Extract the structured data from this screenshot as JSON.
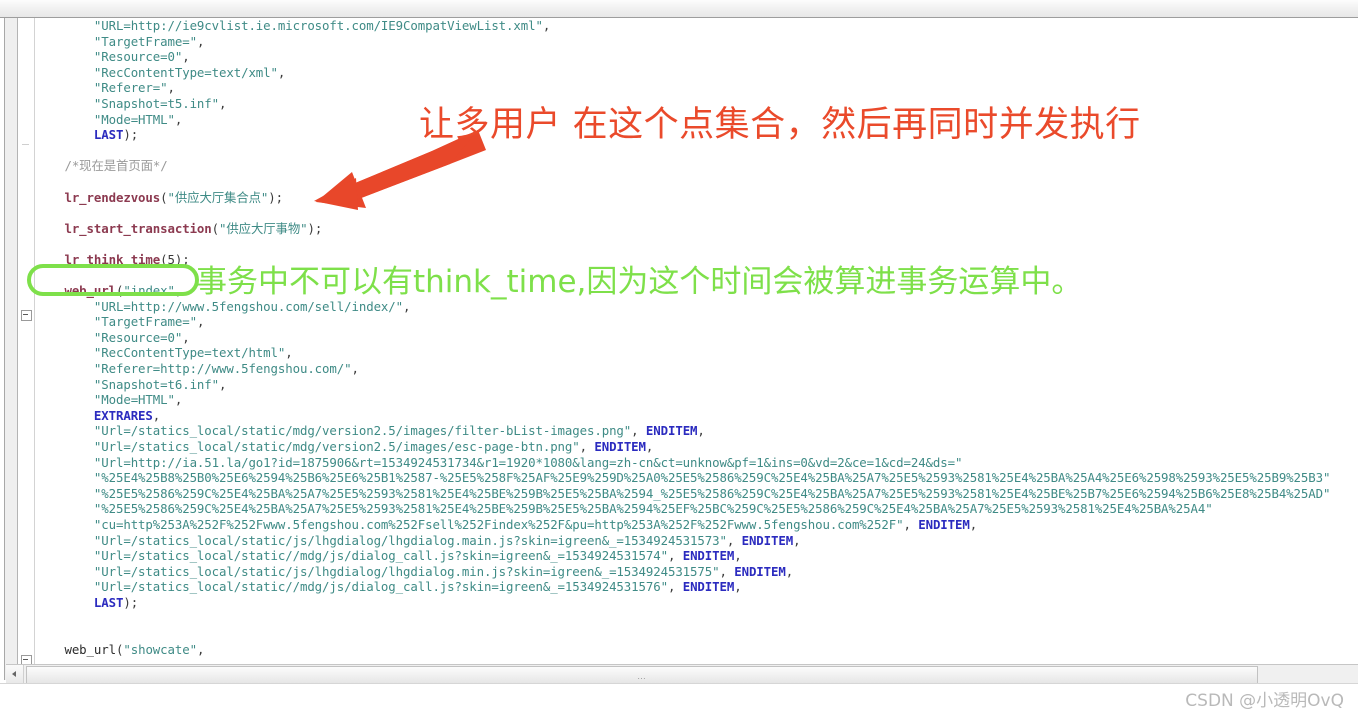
{
  "window": {
    "title": "",
    "scrollbar": {
      "grip_glyph": "…"
    }
  },
  "annotations": {
    "red_note": "让多用户 在这个点集合，然后再同时并发执行",
    "red_note_color": "#ea4a2b",
    "green_note": "事务中不可以有think_time,因为这个时间会被算进事务运算中。",
    "green_note_color": "#7ee04a",
    "highlighted_call": "lr_think_time(5)"
  },
  "watermark": {
    "text": "CSDN @小透明OvQ"
  },
  "colors": {
    "string": "#3f8b86",
    "keyword": "#2b2bbf",
    "function": "#8c3a50",
    "comment": "#9a9a9a",
    "plain": "#2b2b2b",
    "background": "#ffffff"
  },
  "code": {
    "lines": [
      {
        "indent": 8,
        "parts": [
          {
            "t": "str",
            "v": "\"URL=http://ie9cvlist.ie.microsoft.com/IE9CompatViewList.xml\""
          },
          {
            "t": "pun",
            "v": ","
          }
        ]
      },
      {
        "indent": 8,
        "parts": [
          {
            "t": "str",
            "v": "\"TargetFrame=\""
          },
          {
            "t": "pun",
            "v": ","
          }
        ]
      },
      {
        "indent": 8,
        "parts": [
          {
            "t": "str",
            "v": "\"Resource=0\""
          },
          {
            "t": "pun",
            "v": ","
          }
        ]
      },
      {
        "indent": 8,
        "parts": [
          {
            "t": "str",
            "v": "\"RecContentType=text/xml\""
          },
          {
            "t": "pun",
            "v": ","
          }
        ]
      },
      {
        "indent": 8,
        "parts": [
          {
            "t": "str",
            "v": "\"Referer=\""
          },
          {
            "t": "pun",
            "v": ","
          }
        ]
      },
      {
        "indent": 8,
        "parts": [
          {
            "t": "str",
            "v": "\"Snapshot=t5.inf\""
          },
          {
            "t": "pun",
            "v": ","
          }
        ]
      },
      {
        "indent": 8,
        "parts": [
          {
            "t": "str",
            "v": "\"Mode=HTML\""
          },
          {
            "t": "pun",
            "v": ","
          }
        ]
      },
      {
        "indent": 8,
        "parts": [
          {
            "t": "kw",
            "v": "LAST"
          },
          {
            "t": "pun",
            "v": ");"
          }
        ]
      },
      {
        "indent": 0,
        "parts": []
      },
      {
        "indent": 4,
        "parts": [
          {
            "t": "com",
            "v": "/*现在是首页面*/"
          }
        ]
      },
      {
        "indent": 0,
        "parts": []
      },
      {
        "indent": 4,
        "parts": [
          {
            "t": "fn",
            "v": "lr_rendezvous"
          },
          {
            "t": "pun",
            "v": "("
          },
          {
            "t": "str",
            "v": "\"供应大厅集合点\""
          },
          {
            "t": "pun",
            "v": ");"
          }
        ]
      },
      {
        "indent": 0,
        "parts": []
      },
      {
        "indent": 4,
        "parts": [
          {
            "t": "fn",
            "v": "lr_start_transaction"
          },
          {
            "t": "pun",
            "v": "("
          },
          {
            "t": "str",
            "v": "\"供应大厅事物\""
          },
          {
            "t": "pun",
            "v": ");"
          }
        ]
      },
      {
        "indent": 0,
        "parts": []
      },
      {
        "indent": 4,
        "parts": [
          {
            "t": "fn",
            "v": "lr_think_time"
          },
          {
            "t": "pun",
            "v": "(5);"
          }
        ]
      },
      {
        "indent": 0,
        "parts": []
      },
      {
        "indent": 4,
        "parts": [
          {
            "t": "fn",
            "v": "web_url"
          },
          {
            "t": "pun",
            "v": "("
          },
          {
            "t": "str",
            "v": "\"index\""
          },
          {
            "t": "pun",
            "v": ","
          }
        ]
      },
      {
        "indent": 8,
        "parts": [
          {
            "t": "str",
            "v": "\"URL=http://www.5fengshou.com/sell/index/\""
          },
          {
            "t": "pun",
            "v": ","
          }
        ]
      },
      {
        "indent": 8,
        "parts": [
          {
            "t": "str",
            "v": "\"TargetFrame=\""
          },
          {
            "t": "pun",
            "v": ","
          }
        ]
      },
      {
        "indent": 8,
        "parts": [
          {
            "t": "str",
            "v": "\"Resource=0\""
          },
          {
            "t": "pun",
            "v": ","
          }
        ]
      },
      {
        "indent": 8,
        "parts": [
          {
            "t": "str",
            "v": "\"RecContentType=text/html\""
          },
          {
            "t": "pun",
            "v": ","
          }
        ]
      },
      {
        "indent": 8,
        "parts": [
          {
            "t": "str",
            "v": "\"Referer=http://www.5fengshou.com/\""
          },
          {
            "t": "pun",
            "v": ","
          }
        ]
      },
      {
        "indent": 8,
        "parts": [
          {
            "t": "str",
            "v": "\"Snapshot=t6.inf\""
          },
          {
            "t": "pun",
            "v": ","
          }
        ]
      },
      {
        "indent": 8,
        "parts": [
          {
            "t": "str",
            "v": "\"Mode=HTML\""
          },
          {
            "t": "pun",
            "v": ","
          }
        ]
      },
      {
        "indent": 8,
        "parts": [
          {
            "t": "kw",
            "v": "EXTRARES"
          },
          {
            "t": "pun",
            "v": ","
          }
        ]
      },
      {
        "indent": 8,
        "parts": [
          {
            "t": "str",
            "v": "\"Url=/statics_local/static/mdg/version2.5/images/filter-bList-images.png\""
          },
          {
            "t": "pun",
            "v": ", "
          },
          {
            "t": "kw",
            "v": "ENDITEM"
          },
          {
            "t": "pun",
            "v": ","
          }
        ]
      },
      {
        "indent": 8,
        "parts": [
          {
            "t": "str",
            "v": "\"Url=/statics_local/static/mdg/version2.5/images/esc-page-btn.png\""
          },
          {
            "t": "pun",
            "v": ", "
          },
          {
            "t": "kw",
            "v": "ENDITEM"
          },
          {
            "t": "pun",
            "v": ","
          }
        ]
      },
      {
        "indent": 8,
        "parts": [
          {
            "t": "str",
            "v": "\"Url=http://ia.51.la/go1?id=1875906&rt=1534924531734&r1=1920*1080&lang=zh-cn&ct=unknow&pf=1&ins=0&vd=2&ce=1&cd=24&ds=\""
          }
        ]
      },
      {
        "indent": 8,
        "parts": [
          {
            "t": "str",
            "v": "\"%25E4%25B8%25B0%25E6%2594%25B6%25E6%25B1%2587-%25E5%258F%25AF%25E9%259D%25A0%25E5%2586%259C%25E4%25BA%25A7%25E5%2593%2581%25E4%25BA%25A4%25E6%2598%2593%25E5%25B9%25B3\""
          }
        ]
      },
      {
        "indent": 8,
        "parts": [
          {
            "t": "str",
            "v": "\"%25E5%2586%259C%25E4%25BA%25A7%25E5%2593%2581%25E4%25BE%259B%25E5%25BA%2594_%25E5%2586%259C%25E4%25BA%25A7%25E5%2593%2581%25E4%25BE%25B7%25E6%2594%25B6%25E8%25B4%25AD\""
          }
        ]
      },
      {
        "indent": 8,
        "parts": [
          {
            "t": "str",
            "v": "\"%25E5%2586%259C%25E4%25BA%25A7%25E5%2593%2581%25E4%25BE%259B%25E5%25BA%2594%25EF%25BC%259C%25E5%2586%259C%25E4%25BA%25A7%25E5%2593%2581%25E4%25BA%25A4\""
          }
        ]
      },
      {
        "indent": 8,
        "parts": [
          {
            "t": "str",
            "v": "\"cu=http%253A%252F%252Fwww.5fengshou.com%252Fsell%252Findex%252F&pu=http%253A%252F%252Fwww.5fengshou.com%252F\""
          },
          {
            "t": "pun",
            "v": ", "
          },
          {
            "t": "kw",
            "v": "ENDITEM"
          },
          {
            "t": "pun",
            "v": ","
          }
        ]
      },
      {
        "indent": 8,
        "parts": [
          {
            "t": "str",
            "v": "\"Url=/statics_local/static/js/lhgdialog/lhgdialog.main.js?skin=igreen&_=1534924531573\""
          },
          {
            "t": "pun",
            "v": ", "
          },
          {
            "t": "kw",
            "v": "ENDITEM"
          },
          {
            "t": "pun",
            "v": ","
          }
        ]
      },
      {
        "indent": 8,
        "parts": [
          {
            "t": "str",
            "v": "\"Url=/statics_local/static//mdg/js/dialog_call.js?skin=igreen&_=1534924531574\""
          },
          {
            "t": "pun",
            "v": ", "
          },
          {
            "t": "kw",
            "v": "ENDITEM"
          },
          {
            "t": "pun",
            "v": ","
          }
        ]
      },
      {
        "indent": 8,
        "parts": [
          {
            "t": "str",
            "v": "\"Url=/statics_local/static/js/lhgdialog/lhgdialog.min.js?skin=igreen&_=1534924531575\""
          },
          {
            "t": "pun",
            "v": ", "
          },
          {
            "t": "kw",
            "v": "ENDITEM"
          },
          {
            "t": "pun",
            "v": ","
          }
        ]
      },
      {
        "indent": 8,
        "parts": [
          {
            "t": "str",
            "v": "\"Url=/statics_local/static//mdg/js/dialog_call.js?skin=igreen&_=1534924531576\""
          },
          {
            "t": "pun",
            "v": ", "
          },
          {
            "t": "kw",
            "v": "ENDITEM"
          },
          {
            "t": "pun",
            "v": ","
          }
        ]
      },
      {
        "indent": 8,
        "parts": [
          {
            "t": "kw",
            "v": "LAST"
          },
          {
            "t": "pun",
            "v": ");"
          }
        ]
      },
      {
        "indent": 0,
        "parts": []
      },
      {
        "indent": 0,
        "parts": []
      },
      {
        "indent": 4,
        "parts": [
          {
            "t": "plain",
            "v": "web_url"
          },
          {
            "t": "pun",
            "v": "("
          },
          {
            "t": "str",
            "v": "\"showcate\""
          },
          {
            "t": "pun",
            "v": ","
          }
        ]
      }
    ]
  }
}
